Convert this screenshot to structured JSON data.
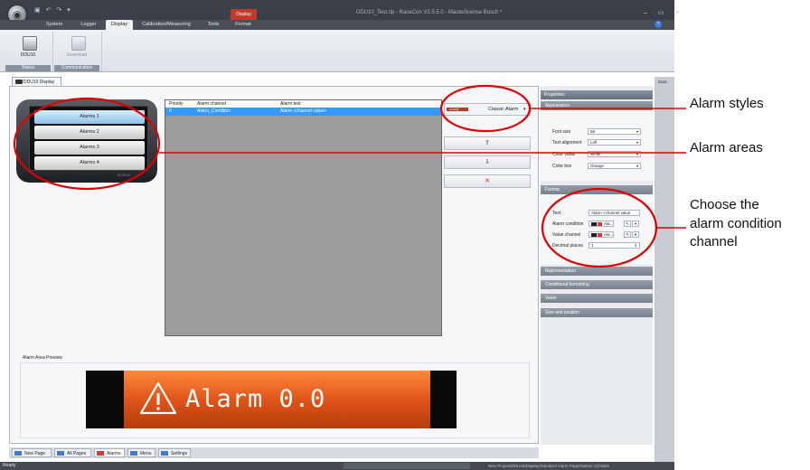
{
  "titlebar": {
    "title": "DDU10_Test.rip - RaceCon V2.5.5.0 - Masterlicense Bosch *",
    "context_tab": "Display",
    "controls": "– ▭ ✕"
  },
  "menu": {
    "tabs": [
      "System",
      "Logger",
      "Display",
      "Calibration/Measuring",
      "Tools",
      "Format"
    ],
    "active": "Display",
    "help": "?"
  },
  "ribbon": {
    "button1": "DDU10",
    "button2": "Download",
    "group1": "Status",
    "group2": "Communication"
  },
  "document_tab": "DDU10 Display",
  "device": {
    "alarm_buttons": [
      "Alarms 1",
      "Alarms 2",
      "Alarms 3",
      "Alarms 4"
    ],
    "selected": "Alarms 1",
    "brand": "BOSCH"
  },
  "table": {
    "headers": [
      "Priority",
      "Alarm channel",
      "Alarm text"
    ],
    "rows": [
      {
        "priority": "0",
        "channel": "Alarm_Condition",
        "text": "Alarm <channel value>"
      }
    ]
  },
  "style_select": {
    "value": "Classic Alarm",
    "chip": "ALARM"
  },
  "actions": {
    "move_up": "⇑",
    "move_down": "⇓",
    "delete": "✕"
  },
  "preview": {
    "label": "Alarm Area Preview",
    "text": "Alarm 0.0",
    "orange": "#e0541a"
  },
  "bottom_tabs": [
    "New Page",
    "All Pages",
    "Alarms",
    "Menu",
    "Settings"
  ],
  "bottom_active": "Alarms",
  "status": {
    "left": "Ready",
    "path": "New Project/DDU10/Display/Standard Alarm Page/Alarms 1@1625"
  },
  "properties": {
    "title": "Properties",
    "sections": {
      "appearance": "Appearance",
      "format": "Format",
      "representation": "Representation",
      "conditional": "Conditional formatting",
      "value": "Value",
      "size": "Size and position"
    },
    "appearance_fields": [
      {
        "label": "Font size",
        "value": "58"
      },
      {
        "label": "Text alignment",
        "value": "Left"
      },
      {
        "label": "Color value",
        "value": "White"
      },
      {
        "label": "Color box",
        "value": "Orange"
      }
    ],
    "format_fields": {
      "text_label": "Text",
      "text_value": "Alarm <channel value",
      "alarm_condition_label": "Alarm condition",
      "alarm_condition_value": "Ala...",
      "value_channel_label": "Value channel",
      "value_channel_value": "Ala...",
      "decimal_label": "Decimal places",
      "decimal_value": "1"
    },
    "side_label": "Data"
  },
  "annotations": {
    "styles": "Alarm styles",
    "areas": "Alarm areas",
    "condition_line1": "Choose the",
    "condition_line2": "alarm condition",
    "condition_line3": "channel"
  },
  "colors": {
    "highlight_circle": "#e00000",
    "selection": "#3399ff"
  }
}
